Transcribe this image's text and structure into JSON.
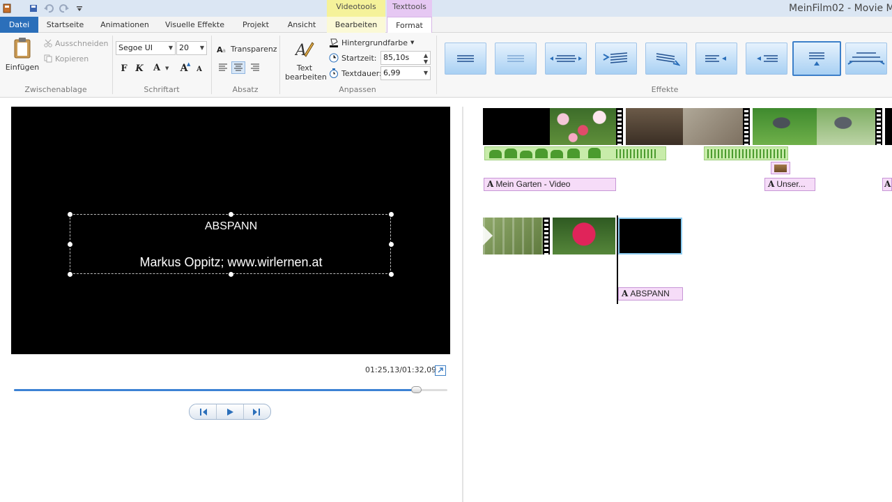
{
  "window": {
    "title": "MeinFilm02 - Movie M",
    "contextual_tabs": {
      "videotools": "Videotools",
      "texttools": "Texttools"
    }
  },
  "quick_access": {
    "icons": [
      "app-icon",
      "save-icon",
      "undo-icon",
      "redo-icon",
      "customize-icon"
    ]
  },
  "tabs": {
    "file": "Datei",
    "items": [
      {
        "label": "Startseite"
      },
      {
        "label": "Animationen"
      },
      {
        "label": "Visuelle Effekte"
      },
      {
        "label": "Projekt"
      },
      {
        "label": "Ansicht"
      },
      {
        "label": "Bearbeiten"
      },
      {
        "label": "Format"
      }
    ],
    "active": "Format"
  },
  "ribbon": {
    "clipboard": {
      "label": "Zwischenablage",
      "paste": "Einfügen",
      "cut": "Ausschneiden",
      "copy": "Kopieren"
    },
    "font": {
      "label": "Schriftart",
      "family": "Segoe UI",
      "size": "20",
      "bold": "F",
      "italic": "K",
      "color": "A",
      "grow": "A",
      "shrink": "A"
    },
    "paragraph": {
      "label": "Absatz",
      "transparency": "Transparenz",
      "alignments": [
        "left",
        "center",
        "right"
      ],
      "active_alignment": "center"
    },
    "adjust": {
      "label": "Anpassen",
      "edit_text": "Text bearbeiten",
      "background_color": "Hintergrundfarbe",
      "start_label": "Startzeit:",
      "start_value": "85,10s",
      "duration_label": "Textdauer:",
      "duration_value": "6,99"
    },
    "effects": {
      "label": "Effekte",
      "items": [
        "effect-none",
        "effect-fade",
        "effect-zoom",
        "effect-fly-lines",
        "effect-slide",
        "effect-fly-left",
        "effect-fly-right",
        "effect-scroll",
        "effect-cinematic"
      ],
      "selected": "effect-scroll"
    }
  },
  "preview": {
    "title": "ABSPANN",
    "subtitle": "Markus Oppitz; www.wirlernen.at",
    "timecode": "01:25,13/01:32,09",
    "progress": 0.93,
    "controls": [
      "previous-frame",
      "play",
      "next-frame"
    ]
  },
  "storyboard": {
    "captions": {
      "garden": "Mein Garten - Video",
      "unser": "Unser...",
      "abspann": "ABSPANN",
      "cap_letter": "A"
    },
    "colors": {
      "caption_bg": "#f6dcf8",
      "audio_bg": "#c8ecaa",
      "accent": "#2b6fba"
    }
  }
}
